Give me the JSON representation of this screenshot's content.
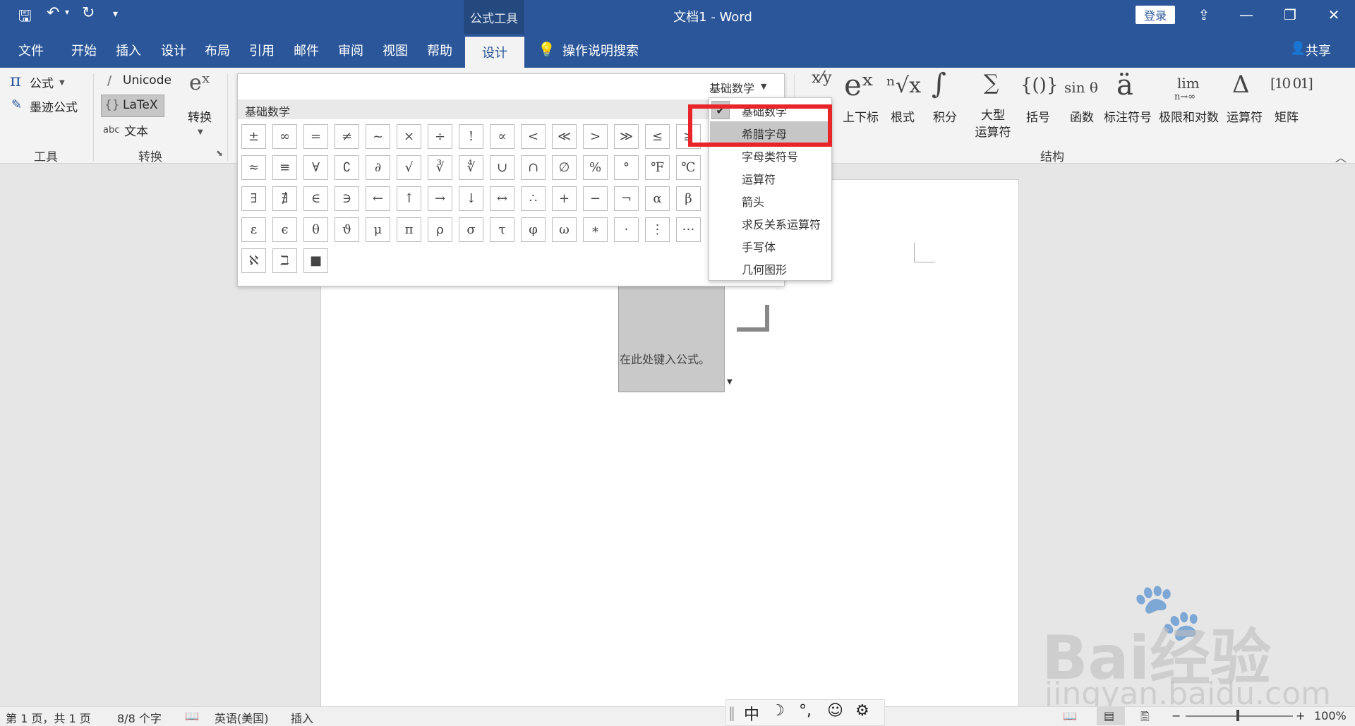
{
  "titlebar": {
    "context_tab": "公式工具",
    "title": "文档1  -  Word",
    "login": "登录",
    "qat_icons": [
      "save-icon",
      "undo-icon",
      "redo-icon",
      "customize-icon"
    ]
  },
  "tabs": [
    "文件",
    "开始",
    "插入",
    "设计",
    "布局",
    "引用",
    "邮件",
    "审阅",
    "视图",
    "帮助"
  ],
  "active_tab": "设计",
  "search_hint": "操作说明搜索",
  "share": "共享",
  "ribbon": {
    "tools": {
      "formula": "公式",
      "ink_formula": "墨迹公式",
      "label": "工具"
    },
    "convert": {
      "unicode": "Unicode",
      "latex": "LaTeX",
      "text": "文本",
      "text_prefix": "abc",
      "convert": "转换",
      "label": "转换"
    },
    "structure_label": "结构",
    "structures": [
      {
        "icon": "eˣ",
        "label": "上下标"
      },
      {
        "icon": "ⁿ√x",
        "label": "根式"
      },
      {
        "icon": "∫",
        "label": "积分"
      },
      {
        "icon": "∑",
        "label": "大型\n运算符"
      },
      {
        "icon": "{()}",
        "label": "括号"
      },
      {
        "icon": "sin θ",
        "label": "函数"
      },
      {
        "icon": "ä",
        "label": "标注符号"
      },
      {
        "icon": "lim",
        "label": "极限和对数"
      },
      {
        "icon": "Δ",
        "label": "运算符"
      },
      {
        "icon": "[10 01]",
        "label": "矩阵"
      }
    ]
  },
  "gallery": {
    "header": "基础数学",
    "category": "基础数学",
    "rows": [
      [
        "±",
        "∞",
        "=",
        "≠",
        "~",
        "×",
        "÷",
        "!",
        "∝",
        "<",
        "≪",
        ">",
        "≫",
        "≤",
        "≥"
      ],
      [
        "≈",
        "≡",
        "∀",
        "∁",
        "∂",
        "√",
        "∛",
        "∜",
        "∪",
        "∩",
        "∅",
        "%",
        "°",
        "℉",
        "℃"
      ],
      [
        "∃",
        "∄",
        "∈",
        "∋",
        "←",
        "↑",
        "→",
        "↓",
        "↔",
        "∴",
        "+",
        "−",
        "¬",
        "α",
        "β"
      ],
      [
        "ε",
        "ϵ",
        "θ",
        "ϑ",
        "μ",
        "π",
        "ρ",
        "σ",
        "τ",
        "φ",
        "ω",
        "∗",
        "·",
        "⋮",
        "⋯"
      ],
      [
        "ℵ",
        "ℶ",
        "■"
      ]
    ]
  },
  "dropdown": {
    "items": [
      "基础数学",
      "希腊字母",
      "字母类符号",
      "运算符",
      "箭头",
      "求反关系运算符",
      "手写体",
      "几何图形"
    ],
    "checked": "基础数学",
    "hovered": "希腊字母"
  },
  "document": {
    "placeholder": "在此处键入公式。"
  },
  "status": {
    "page": "第 1 页，共 1 页",
    "words": "8/8 个字",
    "language": "英语(美国)",
    "mode": "插入",
    "zoom": "100%"
  },
  "ime": [
    "中",
    "☽",
    "°,",
    "☺",
    "⚙"
  ],
  "watermark": {
    "main": "Bai经验",
    "sub": "jingyan.baidu.com"
  }
}
